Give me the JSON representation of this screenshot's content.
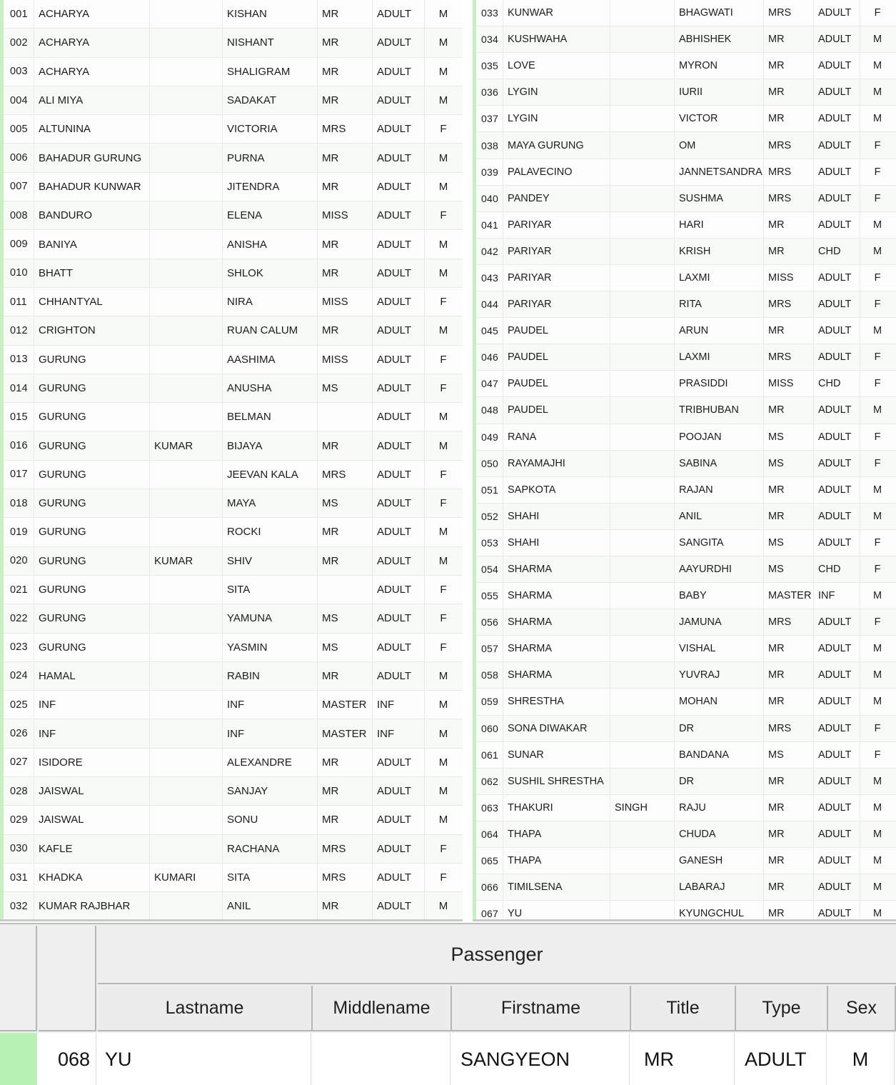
{
  "columns": {
    "id": "#",
    "lastname": "Lastname",
    "middlename": "Middlename",
    "firstname": "Firstname",
    "title": "Title",
    "type": "Type",
    "sex": "Sex"
  },
  "group_header": "Passenger",
  "colors": {
    "selection_green": "#b9f2b5",
    "stripe_green": "#c6f0c2",
    "header_gray": "#ececec",
    "border_gray": "#b6b6b6"
  },
  "left_pane": {
    "rows": [
      {
        "id": "001",
        "lastname": "ACHARYA",
        "middlename": "",
        "firstname": "KISHAN",
        "title": "MR",
        "type": "ADULT",
        "sex": "M"
      },
      {
        "id": "002",
        "lastname": "ACHARYA",
        "middlename": "",
        "firstname": "NISHANT",
        "title": "MR",
        "type": "ADULT",
        "sex": "M"
      },
      {
        "id": "003",
        "lastname": "ACHARYA",
        "middlename": "",
        "firstname": "SHALIGRAM",
        "title": "MR",
        "type": "ADULT",
        "sex": "M"
      },
      {
        "id": "004",
        "lastname": "ALI MIYA",
        "middlename": "",
        "firstname": "SADAKAT",
        "title": "MR",
        "type": "ADULT",
        "sex": "M"
      },
      {
        "id": "005",
        "lastname": "ALTUNINA",
        "middlename": "",
        "firstname": "VICTORIA",
        "title": "MRS",
        "type": "ADULT",
        "sex": "F"
      },
      {
        "id": "006",
        "lastname": "BAHADUR GURUNG",
        "middlename": "",
        "firstname": "PURNA",
        "title": "MR",
        "type": "ADULT",
        "sex": "M"
      },
      {
        "id": "007",
        "lastname": "BAHADUR KUNWAR",
        "middlename": "",
        "firstname": "JITENDRA",
        "title": "MR",
        "type": "ADULT",
        "sex": "M"
      },
      {
        "id": "008",
        "lastname": "BANDURO",
        "middlename": "",
        "firstname": "ELENA",
        "title": "MISS",
        "type": "ADULT",
        "sex": "F"
      },
      {
        "id": "009",
        "lastname": "BANIYA",
        "middlename": "",
        "firstname": "ANISHA",
        "title": "MR",
        "type": "ADULT",
        "sex": "M"
      },
      {
        "id": "010",
        "lastname": "BHATT",
        "middlename": "",
        "firstname": "SHLOK",
        "title": "MR",
        "type": "ADULT",
        "sex": "M"
      },
      {
        "id": "011",
        "lastname": "CHHANTYAL",
        "middlename": "",
        "firstname": "NIRA",
        "title": "MISS",
        "type": "ADULT",
        "sex": "F"
      },
      {
        "id": "012",
        "lastname": "CRIGHTON",
        "middlename": "",
        "firstname": "RUAN CALUM",
        "title": "MR",
        "type": "ADULT",
        "sex": "M"
      },
      {
        "id": "013",
        "lastname": "GURUNG",
        "middlename": "",
        "firstname": "AASHIMA",
        "title": "MISS",
        "type": "ADULT",
        "sex": "F"
      },
      {
        "id": "014",
        "lastname": "GURUNG",
        "middlename": "",
        "firstname": "ANUSHA",
        "title": "MS",
        "type": "ADULT",
        "sex": "F"
      },
      {
        "id": "015",
        "lastname": "GURUNG",
        "middlename": "",
        "firstname": "BELMAN",
        "title": "",
        "type": "ADULT",
        "sex": "M"
      },
      {
        "id": "016",
        "lastname": "GURUNG",
        "middlename": "KUMAR",
        "firstname": "BIJAYA",
        "title": "MR",
        "type": "ADULT",
        "sex": "M"
      },
      {
        "id": "017",
        "lastname": "GURUNG",
        "middlename": "",
        "firstname": "JEEVAN KALA",
        "title": "MRS",
        "type": "ADULT",
        "sex": "F"
      },
      {
        "id": "018",
        "lastname": "GURUNG",
        "middlename": "",
        "firstname": "MAYA",
        "title": "MS",
        "type": "ADULT",
        "sex": "F"
      },
      {
        "id": "019",
        "lastname": "GURUNG",
        "middlename": "",
        "firstname": "ROCKI",
        "title": "MR",
        "type": "ADULT",
        "sex": "M"
      },
      {
        "id": "020",
        "lastname": "GURUNG",
        "middlename": "KUMAR",
        "firstname": "SHIV",
        "title": "MR",
        "type": "ADULT",
        "sex": "M"
      },
      {
        "id": "021",
        "lastname": "GURUNG",
        "middlename": "",
        "firstname": "SITA",
        "title": "",
        "type": "ADULT",
        "sex": "F"
      },
      {
        "id": "022",
        "lastname": "GURUNG",
        "middlename": "",
        "firstname": "YAMUNA",
        "title": "MS",
        "type": "ADULT",
        "sex": "F"
      },
      {
        "id": "023",
        "lastname": "GURUNG",
        "middlename": "",
        "firstname": "YASMIN",
        "title": "MS",
        "type": "ADULT",
        "sex": "F"
      },
      {
        "id": "024",
        "lastname": "HAMAL",
        "middlename": "",
        "firstname": "RABIN",
        "title": "MR",
        "type": "ADULT",
        "sex": "M"
      },
      {
        "id": "025",
        "lastname": "INF",
        "middlename": "",
        "firstname": "INF",
        "title": "MASTER",
        "type": "INF",
        "sex": "M"
      },
      {
        "id": "026",
        "lastname": "INF",
        "middlename": "",
        "firstname": "INF",
        "title": "MASTER",
        "type": "INF",
        "sex": "M"
      },
      {
        "id": "027",
        "lastname": "ISIDORE",
        "middlename": "",
        "firstname": "ALEXANDRE",
        "title": "MR",
        "type": "ADULT",
        "sex": "M"
      },
      {
        "id": "028",
        "lastname": "JAISWAL",
        "middlename": "",
        "firstname": "SANJAY",
        "title": "MR",
        "type": "ADULT",
        "sex": "M"
      },
      {
        "id": "029",
        "lastname": "JAISWAL",
        "middlename": "",
        "firstname": "SONU",
        "title": "MR",
        "type": "ADULT",
        "sex": "M"
      },
      {
        "id": "030",
        "lastname": "KAFLE",
        "middlename": "",
        "firstname": "RACHANA",
        "title": "MRS",
        "type": "ADULT",
        "sex": "F"
      },
      {
        "id": "031",
        "lastname": "KHADKA",
        "middlename": "KUMARI",
        "firstname": "SITA",
        "title": "MRS",
        "type": "ADULT",
        "sex": "F"
      },
      {
        "id": "032",
        "lastname": "KUMAR RAJBHAR",
        "middlename": "",
        "firstname": "ANIL",
        "title": "MR",
        "type": "ADULT",
        "sex": "M"
      }
    ]
  },
  "right_pane": {
    "rows": [
      {
        "id": "033",
        "lastname": "KUNWAR",
        "middlename": "",
        "firstname": "BHAGWATI",
        "title": "MRS",
        "type": "ADULT",
        "sex": "F"
      },
      {
        "id": "034",
        "lastname": "KUSHWAHA",
        "middlename": "",
        "firstname": "ABHISHEK",
        "title": "MR",
        "type": "ADULT",
        "sex": "M"
      },
      {
        "id": "035",
        "lastname": "LOVE",
        "middlename": "",
        "firstname": "MYRON",
        "title": "MR",
        "type": "ADULT",
        "sex": "M"
      },
      {
        "id": "036",
        "lastname": "LYGIN",
        "middlename": "",
        "firstname": "IURII",
        "title": "MR",
        "type": "ADULT",
        "sex": "M"
      },
      {
        "id": "037",
        "lastname": "LYGIN",
        "middlename": "",
        "firstname": "VICTOR",
        "title": "MR",
        "type": "ADULT",
        "sex": "M"
      },
      {
        "id": "038",
        "lastname": "MAYA GURUNG",
        "middlename": "",
        "firstname": "OM",
        "title": "MRS",
        "type": "ADULT",
        "sex": "F"
      },
      {
        "id": "039",
        "lastname": "PALAVECINO",
        "middlename": "",
        "firstname": "JANNETSANDRA",
        "title": "MRS",
        "type": "ADULT",
        "sex": "F"
      },
      {
        "id": "040",
        "lastname": "PANDEY",
        "middlename": "",
        "firstname": "SUSHMA",
        "title": "MRS",
        "type": "ADULT",
        "sex": "F"
      },
      {
        "id": "041",
        "lastname": "PARIYAR",
        "middlename": "",
        "firstname": "HARI",
        "title": "MR",
        "type": "ADULT",
        "sex": "M"
      },
      {
        "id": "042",
        "lastname": "PARIYAR",
        "middlename": "",
        "firstname": "KRISH",
        "title": "MR",
        "type": "CHD",
        "sex": "M"
      },
      {
        "id": "043",
        "lastname": "PARIYAR",
        "middlename": "",
        "firstname": "LAXMI",
        "title": "MISS",
        "type": "ADULT",
        "sex": "F"
      },
      {
        "id": "044",
        "lastname": "PARIYAR",
        "middlename": "",
        "firstname": "RITA",
        "title": "MRS",
        "type": "ADULT",
        "sex": "F"
      },
      {
        "id": "045",
        "lastname": "PAUDEL",
        "middlename": "",
        "firstname": "ARUN",
        "title": "MR",
        "type": "ADULT",
        "sex": "M"
      },
      {
        "id": "046",
        "lastname": "PAUDEL",
        "middlename": "",
        "firstname": "LAXMI",
        "title": "MRS",
        "type": "ADULT",
        "sex": "F"
      },
      {
        "id": "047",
        "lastname": "PAUDEL",
        "middlename": "",
        "firstname": "PRASIDDI",
        "title": "MISS",
        "type": "CHD",
        "sex": "F"
      },
      {
        "id": "048",
        "lastname": "PAUDEL",
        "middlename": "",
        "firstname": "TRIBHUBAN",
        "title": "MR",
        "type": "ADULT",
        "sex": "M"
      },
      {
        "id": "049",
        "lastname": "RANA",
        "middlename": "",
        "firstname": "POOJAN",
        "title": "MS",
        "type": "ADULT",
        "sex": "F"
      },
      {
        "id": "050",
        "lastname": "RAYAMAJHI",
        "middlename": "",
        "firstname": "SABINA",
        "title": "MS",
        "type": "ADULT",
        "sex": "F"
      },
      {
        "id": "051",
        "lastname": "SAPKOTA",
        "middlename": "",
        "firstname": "RAJAN",
        "title": "MR",
        "type": "ADULT",
        "sex": "M"
      },
      {
        "id": "052",
        "lastname": "SHAHI",
        "middlename": "",
        "firstname": "ANIL",
        "title": "MR",
        "type": "ADULT",
        "sex": "M"
      },
      {
        "id": "053",
        "lastname": "SHAHI",
        "middlename": "",
        "firstname": "SANGITA",
        "title": "MS",
        "type": "ADULT",
        "sex": "F"
      },
      {
        "id": "054",
        "lastname": "SHARMA",
        "middlename": "",
        "firstname": "AAYURDHI",
        "title": "MS",
        "type": "CHD",
        "sex": "F"
      },
      {
        "id": "055",
        "lastname": "SHARMA",
        "middlename": "",
        "firstname": "BABY",
        "title": "MASTER",
        "type": "INF",
        "sex": "M"
      },
      {
        "id": "056",
        "lastname": "SHARMA",
        "middlename": "",
        "firstname": "JAMUNA",
        "title": "MRS",
        "type": "ADULT",
        "sex": "F"
      },
      {
        "id": "057",
        "lastname": "SHARMA",
        "middlename": "",
        "firstname": "VISHAL",
        "title": "MR",
        "type": "ADULT",
        "sex": "M"
      },
      {
        "id": "058",
        "lastname": "SHARMA",
        "middlename": "",
        "firstname": "YUVRAJ",
        "title": "MR",
        "type": "ADULT",
        "sex": "M"
      },
      {
        "id": "059",
        "lastname": "SHRESTHA",
        "middlename": "",
        "firstname": "MOHAN",
        "title": "MR",
        "type": "ADULT",
        "sex": "M"
      },
      {
        "id": "060",
        "lastname": "SONA DIWAKAR",
        "middlename": "",
        "firstname": "DR",
        "title": "MRS",
        "type": "ADULT",
        "sex": "F"
      },
      {
        "id": "061",
        "lastname": "SUNAR",
        "middlename": "",
        "firstname": "BANDANA",
        "title": "MS",
        "type": "ADULT",
        "sex": "F"
      },
      {
        "id": "062",
        "lastname": "SUSHIL SHRESTHA",
        "middlename": "",
        "firstname": "DR",
        "title": "MR",
        "type": "ADULT",
        "sex": "M"
      },
      {
        "id": "063",
        "lastname": "THAKURI",
        "middlename": "SINGH",
        "firstname": "RAJU",
        "title": "MR",
        "type": "ADULT",
        "sex": "M"
      },
      {
        "id": "064",
        "lastname": "THAPA",
        "middlename": "",
        "firstname": "CHUDA",
        "title": "MR",
        "type": "ADULT",
        "sex": "M"
      },
      {
        "id": "065",
        "lastname": "THAPA",
        "middlename": "",
        "firstname": "GANESH",
        "title": "MR",
        "type": "ADULT",
        "sex": "M"
      },
      {
        "id": "066",
        "lastname": "TIMILSENA",
        "middlename": "",
        "firstname": "LABARAJ",
        "title": "MR",
        "type": "ADULT",
        "sex": "M"
      },
      {
        "id": "067",
        "lastname": "YU",
        "middlename": "",
        "firstname": "KYUNGCHUL",
        "title": "MR",
        "type": "ADULT",
        "sex": "M"
      }
    ]
  },
  "detail_row": {
    "id": "068",
    "lastname": "YU",
    "middlename": "",
    "firstname": "SANGYEON",
    "title": "MR",
    "type": "ADULT",
    "sex": "M"
  }
}
